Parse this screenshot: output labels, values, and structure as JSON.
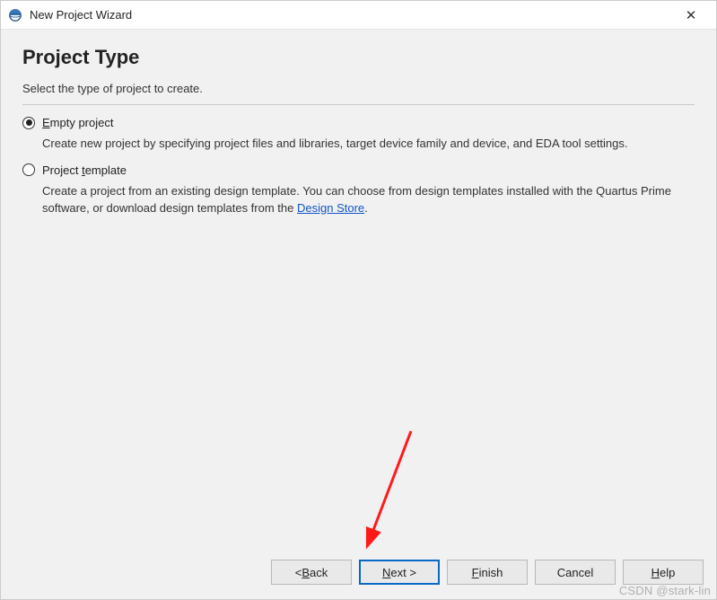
{
  "titlebar": {
    "title": "New Project Wizard"
  },
  "heading": "Project Type",
  "subheading": "Select the type of project to create.",
  "options": [
    {
      "label_pre": "",
      "label_mn": "E",
      "label_post": "mpty project",
      "checked": true,
      "desc": "Create new project by specifying project files and libraries, target device family and device, and EDA tool settings."
    },
    {
      "label_pre": "Project ",
      "label_mn": "t",
      "label_post": "emplate",
      "checked": false,
      "desc_pre": "Create a project from an existing design template. You can choose from design templates installed with the Quartus Prime software, or download design templates from the ",
      "link": "Design Store",
      "desc_post": "."
    }
  ],
  "buttons": {
    "back_pre": "< ",
    "back_mn": "B",
    "back_post": "ack",
    "next_mn": "N",
    "next_post": "ext >",
    "finish_mn": "F",
    "finish_post": "inish",
    "cancel": "Cancel",
    "help_mn": "H",
    "help_post": "elp"
  },
  "watermark": "CSDN @stark-lin"
}
